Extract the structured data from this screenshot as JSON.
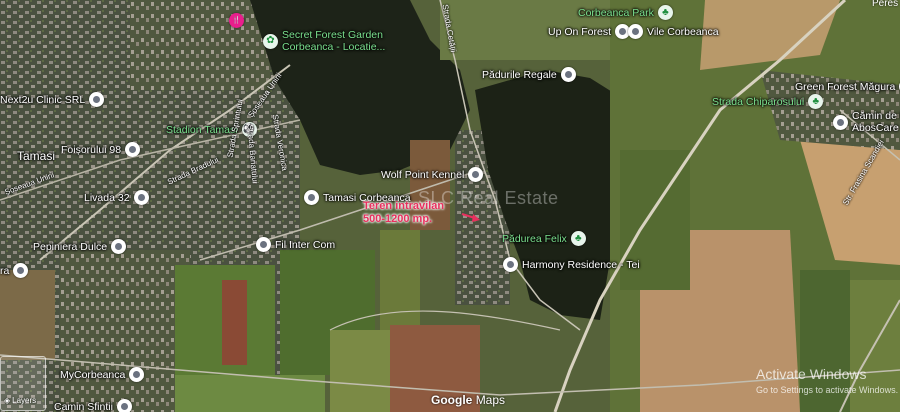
{
  "map": {
    "watermark": "SLC Real Estate",
    "plot_label": {
      "line1": "Teren intravilan",
      "line2": "500-1200 mp."
    },
    "google_logo": {
      "brand": "Google",
      "product": "Maps"
    },
    "layers_label": "Layers",
    "activate_windows": {
      "title": "Activate Windows",
      "subtitle": "Go to Settings to activate Windows."
    },
    "partial_top_right": "Peres",
    "accent_colors": {
      "park_green": "#7be08e",
      "plot_label": "#e8305e",
      "pink_pin": "#e91e8c"
    },
    "pins": [
      {
        "id": "secret-forest",
        "line1": "Secret Forest Garden",
        "line2": "Corbeanca - Locatie...",
        "type": "green",
        "icon": "flower-icon"
      },
      {
        "id": "corbeanca-park",
        "line1": "Corbeanca Park",
        "type": "green",
        "icon": "tree-icon"
      },
      {
        "id": "up-on-forest",
        "line1": "Up On Forest",
        "type": "gray"
      },
      {
        "id": "vile-corbeanca",
        "line1": "Vile Corbeanca",
        "type": "gray"
      },
      {
        "id": "padurile-regale",
        "line1": "Pădurile Regale",
        "type": "gray"
      },
      {
        "id": "green-forest",
        "line1": "Green Forest Măgura",
        "type": "gray"
      },
      {
        "id": "camin",
        "line1": "Cămin de B",
        "line2": "AbosCare",
        "type": "gray"
      },
      {
        "id": "strada-chiparosului",
        "line1": "Strada Chiparosului",
        "type": "green",
        "icon": "tree-icon"
      },
      {
        "id": "next2u",
        "line1": "Next2u Clinic SRL",
        "type": "gray"
      },
      {
        "id": "stadion",
        "line1": "Stadion Tamasi",
        "type": "green",
        "icon": "stadium-icon"
      },
      {
        "id": "foisorului",
        "line1": "Foișorului 98",
        "type": "gray"
      },
      {
        "id": "tamasi",
        "line1": "Tamasi",
        "type": "none"
      },
      {
        "id": "wolf-point",
        "line1": "Wolf Point Kennel",
        "type": "gray"
      },
      {
        "id": "tamasi-corbeanca",
        "line1": "Tamasi Corbeanca",
        "type": "gray"
      },
      {
        "id": "livada",
        "line1": "Livada 32",
        "type": "gray"
      },
      {
        "id": "padurea-felix",
        "line1": "Pădurea Felix",
        "type": "green",
        "icon": "tree-icon"
      },
      {
        "id": "fil-inter",
        "line1": "Fil Inter Com",
        "type": "gray"
      },
      {
        "id": "pepiniera",
        "line1": "Pepiniera Dulce",
        "type": "gray"
      },
      {
        "id": "harmony",
        "line1": "Harmony Residence - Tei",
        "type": "gray"
      },
      {
        "id": "ra",
        "line1": "ra",
        "type": "gray"
      },
      {
        "id": "mycorbeanca",
        "line1": "MyCorbeanca",
        "type": "gray"
      },
      {
        "id": "camin-sfintii",
        "line1": "Camin Sfintii",
        "type": "gray"
      },
      {
        "id": "pink-poi",
        "line1": "",
        "type": "pink",
        "icon": "restaurant-icon"
      }
    ],
    "streets": [
      {
        "id": "strada-cetatii",
        "text": "Strada Cetății"
      },
      {
        "id": "sos-unirii-1",
        "text": "Șoseaua Unirii"
      },
      {
        "id": "strada-veronica",
        "text": "Strada Veronica"
      },
      {
        "id": "strada-banatului",
        "text": "Strada Banatului"
      },
      {
        "id": "strada-sprintului",
        "text": "Strada Sprintului"
      },
      {
        "id": "sos-unirii-2",
        "text": "Șoseaua Unirii"
      },
      {
        "id": "strada-bradului",
        "text": "Strada Bradului"
      },
      {
        "id": "str-frasina",
        "text": "Str. Frasina Scandiei"
      }
    ]
  }
}
